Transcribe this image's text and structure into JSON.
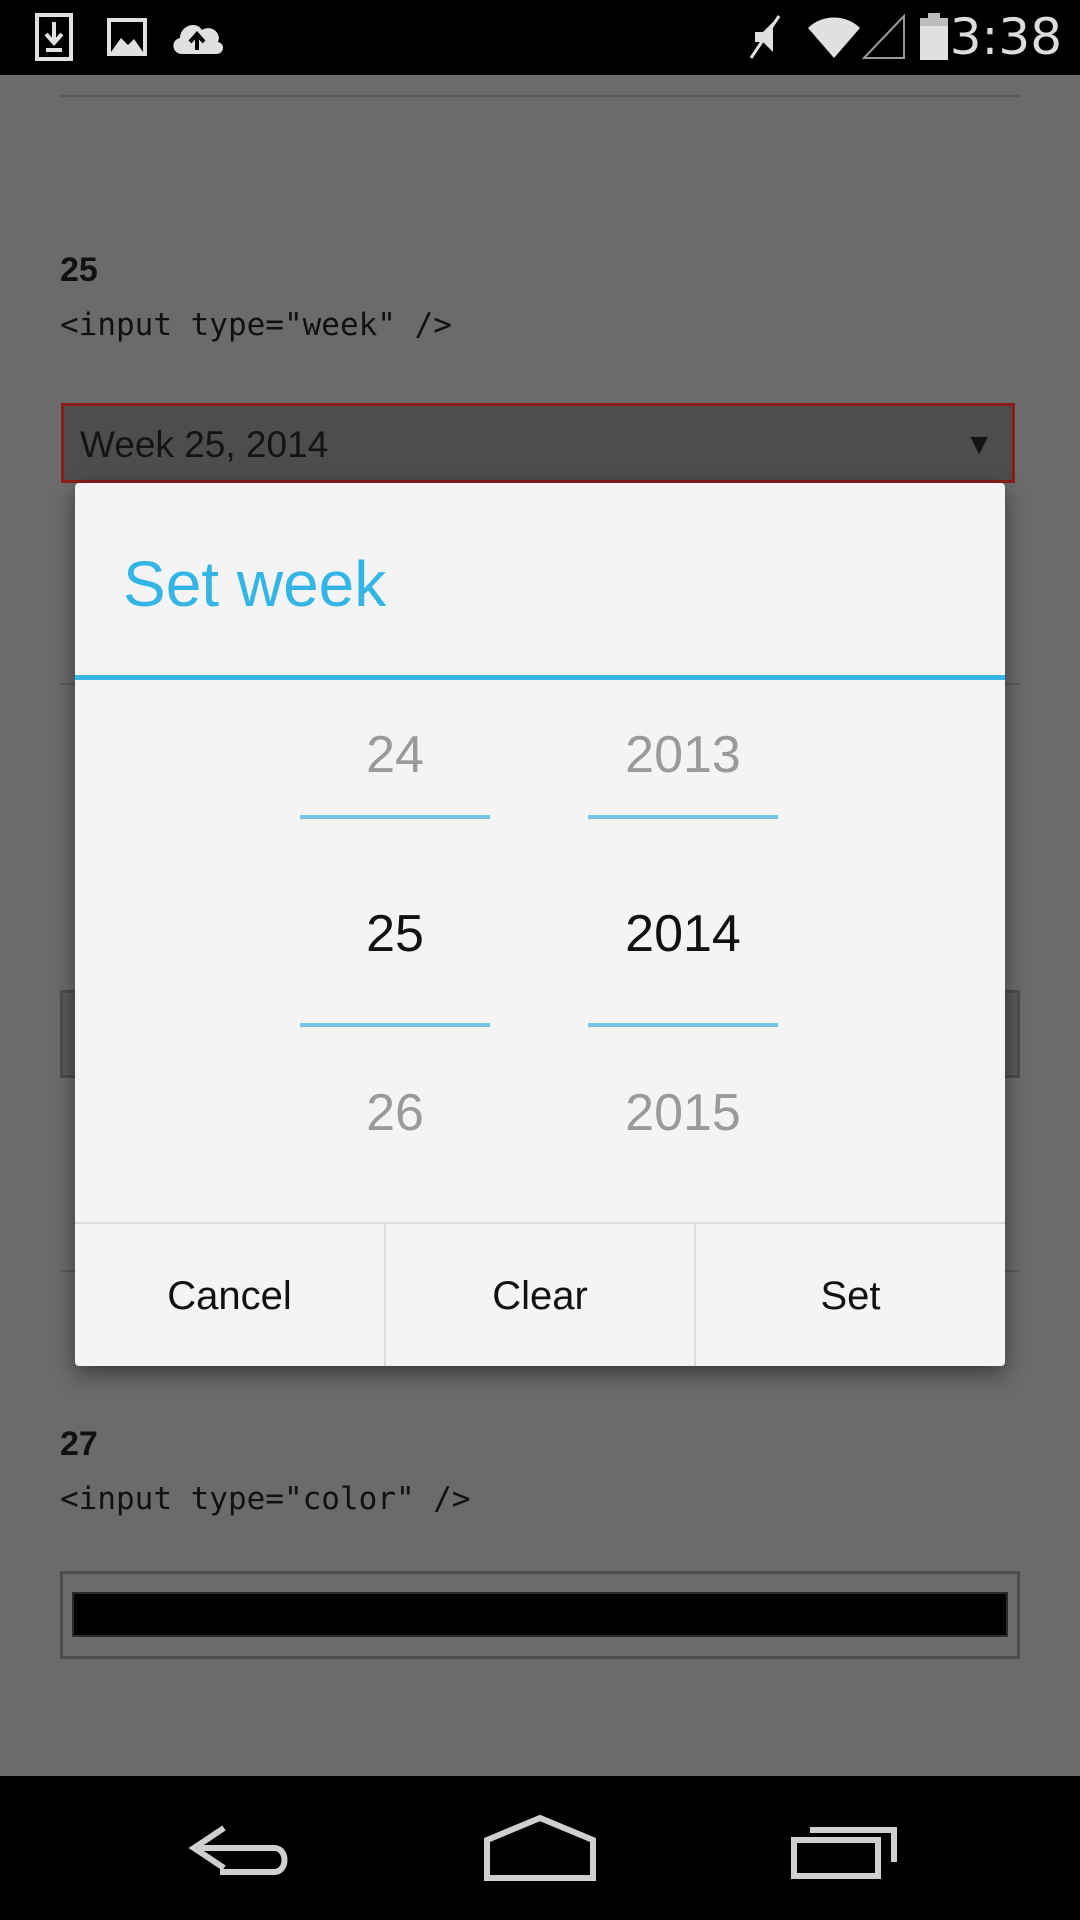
{
  "status_bar": {
    "time": "3:38",
    "left_icons": [
      "download-icon",
      "image-icon",
      "cloud-upload-icon"
    ],
    "right_icons": [
      "mute-icon",
      "wifi-icon",
      "cell-signal-icon",
      "battery-icon"
    ]
  },
  "page": {
    "section_25": {
      "number": "25",
      "code": "<input type=\"week\" />",
      "field_value": "Week 25, 2014",
      "caret": "▼"
    },
    "section_27": {
      "number": "27",
      "code": "<input type=\"color\" />",
      "color_value": "#000000"
    }
  },
  "dialog": {
    "title": "Set week",
    "week_picker": {
      "prev": "24",
      "current": "25",
      "next": "26"
    },
    "year_picker": {
      "prev": "2013",
      "current": "2014",
      "next": "2015"
    },
    "buttons": {
      "cancel": "Cancel",
      "clear": "Clear",
      "set": "Set"
    }
  },
  "nav_bar": {
    "buttons": [
      "back-icon",
      "home-icon",
      "recents-icon"
    ]
  },
  "colors": {
    "accent": "#33b5e5",
    "overlay_bg": "#6b6b6b",
    "dialog_bg": "#f4f4f4"
  }
}
